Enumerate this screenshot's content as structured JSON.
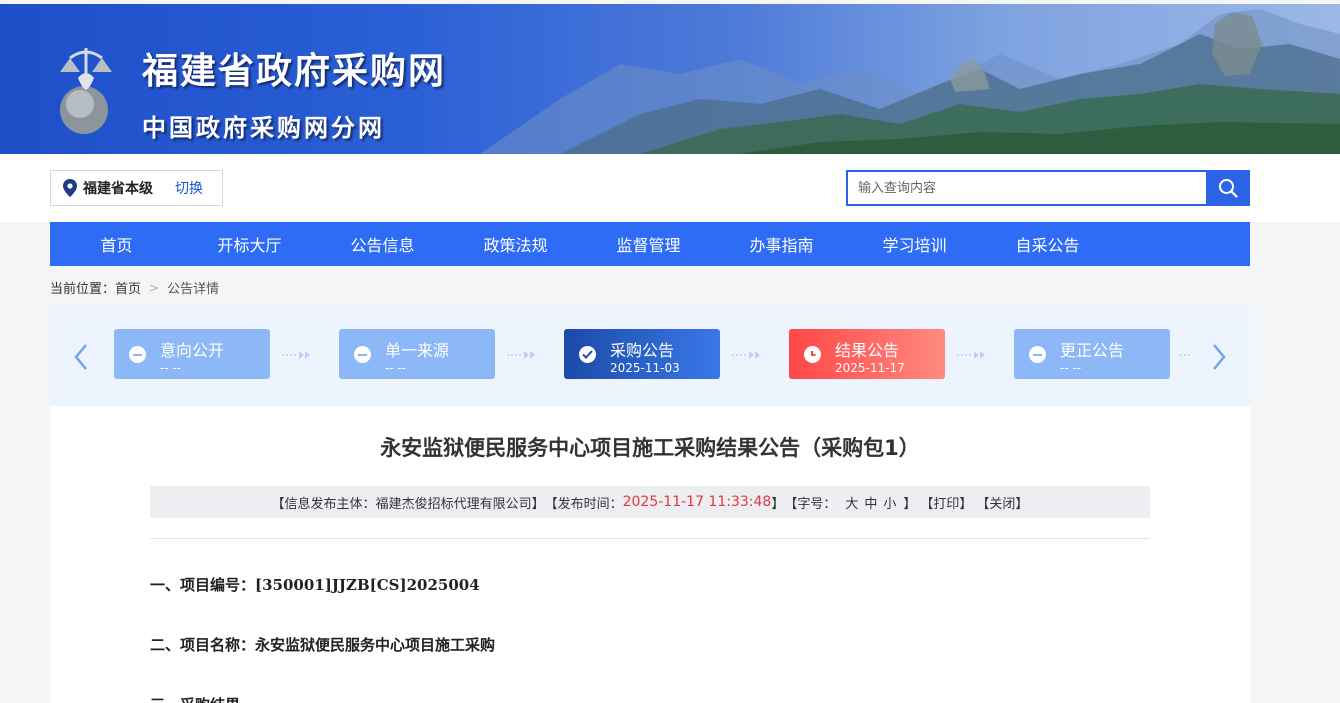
{
  "banner": {
    "title": "福建省政府采购网",
    "subtitle": "中国政府采购网分网"
  },
  "region": {
    "name": "福建省本级",
    "switch_label": "切换"
  },
  "search": {
    "placeholder": "输入查询内容"
  },
  "nav": {
    "items": [
      "首页",
      "开标大厅",
      "公告信息",
      "政策法规",
      "监督管理",
      "办事指南",
      "学习培训",
      "自采公告"
    ]
  },
  "breadcrumb": {
    "prefix": "当前位置：",
    "home": "首页",
    "current": "公告详情"
  },
  "steps": [
    {
      "label": "意向公开",
      "date": "-- --",
      "state": "inactive"
    },
    {
      "label": "单一来源",
      "date": "-- --",
      "state": "inactive"
    },
    {
      "label": "采购公告",
      "date": "2025-11-03",
      "state": "done"
    },
    {
      "label": "结果公告",
      "date": "2025-11-17",
      "state": "current"
    },
    {
      "label": "更正公告",
      "date": "-- --",
      "state": "inactive"
    }
  ],
  "article": {
    "title": "永安监狱便民服务中心项目施工采购结果公告（采购包1）",
    "meta": {
      "publisher_label": "【信息发布主体：",
      "publisher": "福建杰俊招标代理有限公司",
      "publisher_end": "】",
      "time_label": "【发布时间：",
      "time": "2025-11-17 11:33:48",
      "time_end": "】",
      "font_label": "【字号：",
      "font_large": "大",
      "font_medium": "中",
      "font_small": "小",
      "font_end": "】",
      "print": "【打印】",
      "close": "【关闭】"
    },
    "paragraphs": [
      "一、项目编号：[350001]JJZB[CS]2025004",
      "二、项目名称：永安监狱便民服务中心项目施工采购",
      "三、采购结果"
    ]
  },
  "colors": {
    "nav_bg": "#2e6cf6",
    "accent": "#2d64e6",
    "time_red": "#e4393c",
    "step_inactive": "#8db8f7",
    "step_done": "#1b4aa8",
    "step_current": "#ff4747"
  }
}
